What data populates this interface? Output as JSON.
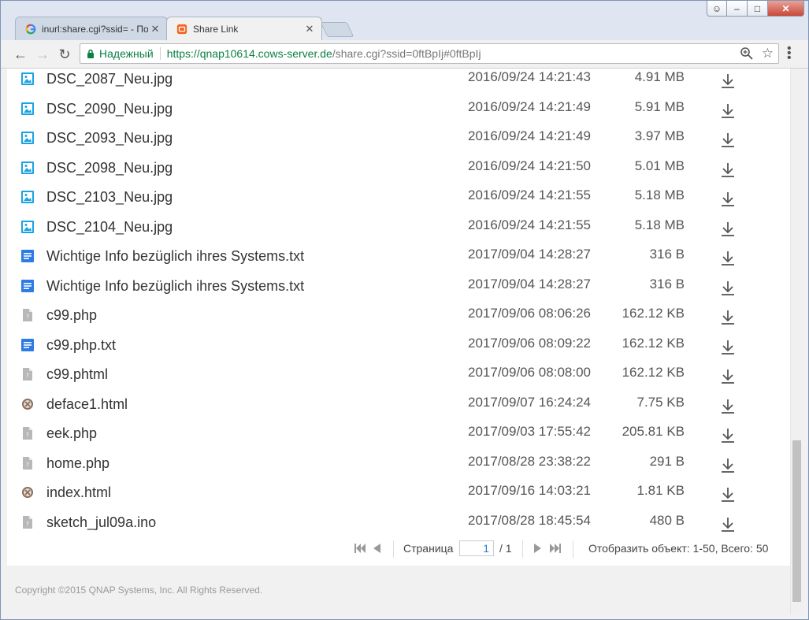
{
  "browser": {
    "tabs": [
      {
        "label": "inurl:share.cgi?ssid= - По",
        "favicon": "google-icon"
      },
      {
        "label": "Share Link",
        "favicon": "qnap-share-icon"
      }
    ],
    "secure_label": "Надежный",
    "url_host": "https://qnap10614.cows-server.de",
    "url_path": "/share.cgi?ssid=0ftBpIj#0ftBpIj"
  },
  "files": [
    {
      "name": "DSC_2087_Neu.jpg",
      "date": "2016/09/24 14:21:43",
      "size": "4.91 MB",
      "icon": "image-file-icon"
    },
    {
      "name": "DSC_2090_Neu.jpg",
      "date": "2016/09/24 14:21:49",
      "size": "5.91 MB",
      "icon": "image-file-icon"
    },
    {
      "name": "DSC_2093_Neu.jpg",
      "date": "2016/09/24 14:21:49",
      "size": "3.97 MB",
      "icon": "image-file-icon"
    },
    {
      "name": "DSC_2098_Neu.jpg",
      "date": "2016/09/24 14:21:50",
      "size": "5.01 MB",
      "icon": "image-file-icon"
    },
    {
      "name": "DSC_2103_Neu.jpg",
      "date": "2016/09/24 14:21:55",
      "size": "5.18 MB",
      "icon": "image-file-icon"
    },
    {
      "name": "DSC_2104_Neu.jpg",
      "date": "2016/09/24 14:21:55",
      "size": "5.18 MB",
      "icon": "image-file-icon"
    },
    {
      "name": "Wichtige Info bezüglich ihres Systems.txt",
      "date": "2017/09/04 14:28:27",
      "size": "316 B",
      "icon": "text-file-icon"
    },
    {
      "name": "Wichtige Info bezüglich ihres Systems.txt",
      "date": "2017/09/04 14:28:27",
      "size": "316 B",
      "icon": "text-file-icon"
    },
    {
      "name": "c99.php",
      "date": "2017/09/06 08:06:26",
      "size": "162.12 KB",
      "icon": "unknown-file-icon"
    },
    {
      "name": "c99.php.txt",
      "date": "2017/09/06 08:09:22",
      "size": "162.12 KB",
      "icon": "text-file-icon"
    },
    {
      "name": "c99.phtml",
      "date": "2017/09/06 08:08:00",
      "size": "162.12 KB",
      "icon": "unknown-file-icon"
    },
    {
      "name": "deface1.html",
      "date": "2017/09/07 16:24:24",
      "size": "7.75 KB",
      "icon": "html-file-icon"
    },
    {
      "name": "eek.php",
      "date": "2017/09/03 17:55:42",
      "size": "205.81 KB",
      "icon": "unknown-file-icon"
    },
    {
      "name": "home.php",
      "date": "2017/08/28 23:38:22",
      "size": "291 B",
      "icon": "unknown-file-icon"
    },
    {
      "name": "index.html",
      "date": "2017/09/16 14:03:21",
      "size": "1.81 KB",
      "icon": "html-file-icon"
    },
    {
      "name": "sketch_jul09a.ino",
      "date": "2017/08/28 18:45:54",
      "size": "480 B",
      "icon": "unknown-file-icon"
    }
  ],
  "pager": {
    "page_label": "Страница",
    "current_page": "1",
    "total_pages": "/ 1",
    "summary": "Отобразить объект: 1-50, Всего: 50"
  },
  "footer": {
    "copyright": "Copyright ©2015 QNAP Systems, Inc. All Rights Reserved."
  },
  "colors": {
    "secure_green": "#0b8043",
    "image_icon": "#1aa3e3",
    "text_icon": "#2d7be5",
    "unknown_icon": "#b8b8b8",
    "html_icon": "#8a6e5e"
  }
}
